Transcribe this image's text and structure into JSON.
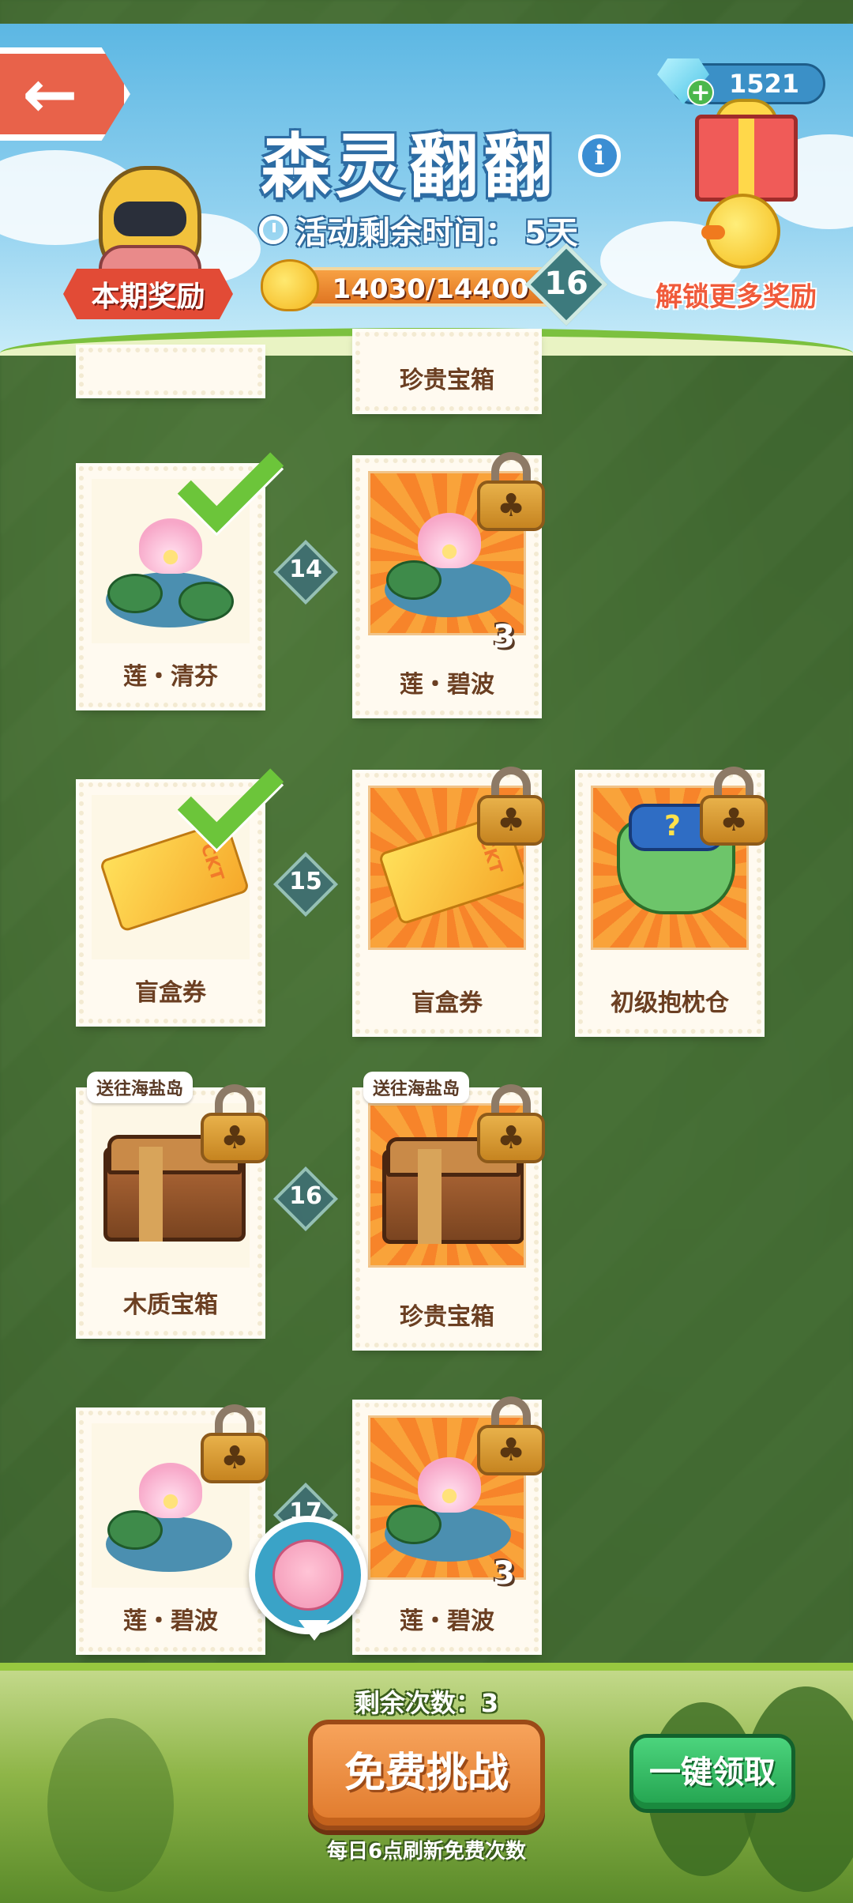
{
  "header": {
    "title": "森灵翻翻",
    "timer_label": "活动剩余时间：",
    "timer_value": "5天",
    "progress_text": "14030/14400",
    "progress_fraction": 0.974,
    "level": "16",
    "current_reward_label": "本期奖励",
    "gems": "1521",
    "unlock_more_label": "解锁更多奖励"
  },
  "rows": [
    {
      "level": "",
      "cards": [
        {
          "label": "",
          "state": "claimed"
        },
        {
          "label": "珍贵宝箱",
          "state": "locked"
        }
      ]
    },
    {
      "level": "14",
      "cards": [
        {
          "label": "莲・清芬",
          "state": "claimed",
          "icon": "lotus-icon"
        },
        {
          "label": "莲・碧波",
          "state": "locked",
          "count": "3",
          "icon": "lotus-icon"
        }
      ]
    },
    {
      "level": "15",
      "cards": [
        {
          "label": "盲盒券",
          "state": "claimed",
          "icon": "ticket-icon"
        },
        {
          "label": "盲盒券",
          "state": "locked",
          "icon": "ticket-icon"
        },
        {
          "label": "初级抱枕仓",
          "state": "locked",
          "icon": "pillow-bag-icon"
        }
      ]
    },
    {
      "level": "16",
      "cards": [
        {
          "label": "木质宝箱",
          "state": "locked",
          "dest": "送往海盐岛",
          "icon": "wooden-chest-icon"
        },
        {
          "label": "珍贵宝箱",
          "state": "locked",
          "dest": "送往海盐岛",
          "icon": "precious-chest-icon"
        }
      ]
    },
    {
      "level": "17",
      "cards": [
        {
          "label": "莲・碧波",
          "state": "locked",
          "icon": "lotus-icon"
        },
        {
          "label": "莲・碧波",
          "state": "locked",
          "count": "3",
          "icon": "lotus-icon"
        }
      ]
    }
  ],
  "footer": {
    "remaining_label": "剩余次数：3",
    "free_challenge_label": "免费挑战",
    "claim_all_label": "一键领取",
    "refresh_note": "每日6点刷新免费次数"
  },
  "colors": {
    "sky": "#5cb7e3",
    "accent_orange": "#e07a2c",
    "accent_green": "#22a24e",
    "claimed_check": "#6cc53a"
  }
}
